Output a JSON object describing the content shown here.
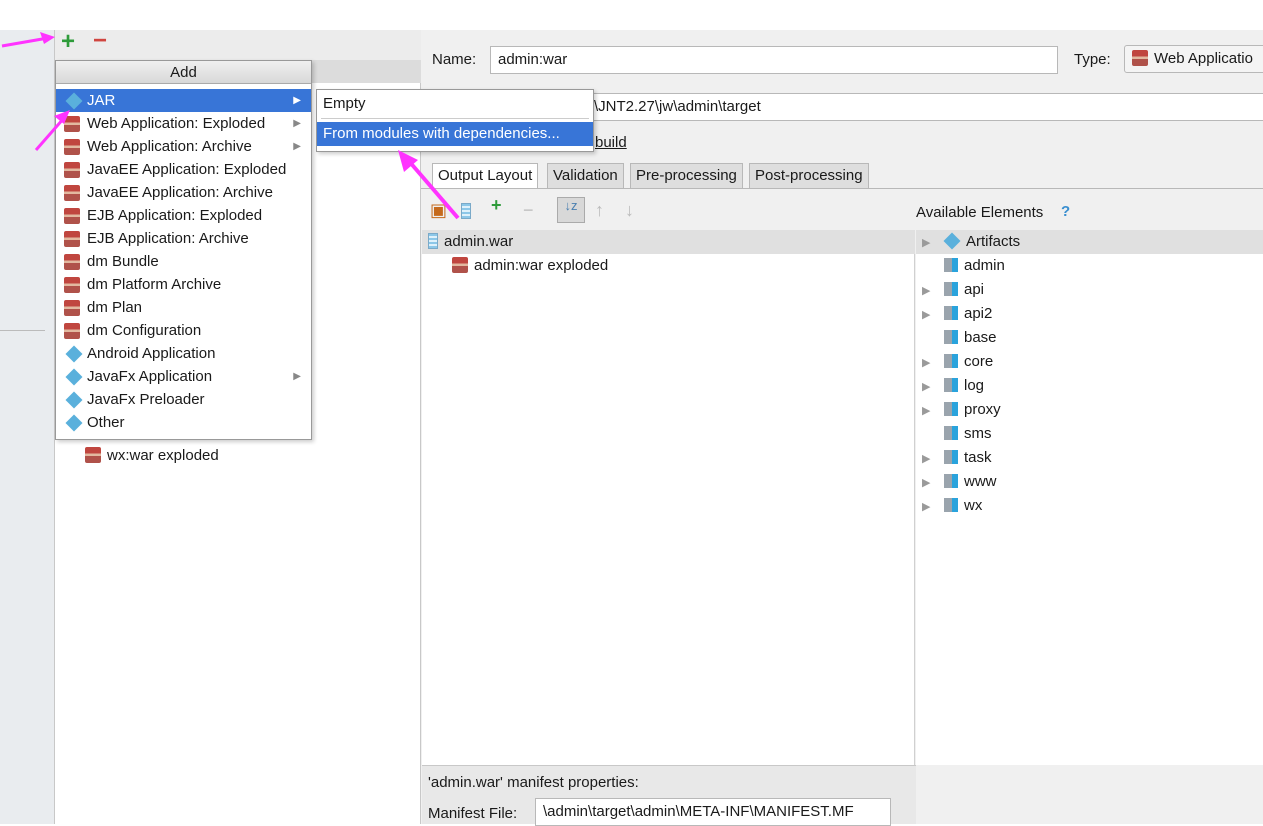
{
  "left_panel": {
    "toolbar": {
      "add_icon": "plus-icon",
      "remove_icon": "minus-icon"
    },
    "tree_items": [
      {
        "label": "wx:war exploded",
        "icon": "web-app-icon"
      }
    ]
  },
  "form": {
    "name_label": "Name:",
    "name_value": "admin:war",
    "type_label": "Type:",
    "type_value": "Web Applicatio",
    "output_dir_value": "\\JNT2.27\\jw\\admin\\target",
    "build_label": "build"
  },
  "tabs": [
    {
      "label": "Output Layout",
      "active": true
    },
    {
      "label": "Validation"
    },
    {
      "label": "Pre-processing"
    },
    {
      "label": "Post-processing"
    }
  ],
  "layout_tree": [
    {
      "label": "admin.war",
      "icon": "war-jar-icon",
      "selected": true
    },
    {
      "label": "admin:war exploded",
      "icon": "web-app-icon"
    }
  ],
  "available": {
    "title": "Available Elements",
    "help": "?",
    "items": [
      {
        "label": "Artifacts",
        "expandable": true,
        "icon": "artifacts-icon"
      },
      {
        "label": "admin",
        "expandable": false
      },
      {
        "label": "api",
        "expandable": true
      },
      {
        "label": "api2",
        "expandable": true
      },
      {
        "label": "base",
        "expandable": false
      },
      {
        "label": "core",
        "expandable": true
      },
      {
        "label": "log",
        "expandable": true
      },
      {
        "label": "proxy",
        "expandable": true
      },
      {
        "label": "sms",
        "expandable": false
      },
      {
        "label": "task",
        "expandable": true
      },
      {
        "label": "www",
        "expandable": true
      },
      {
        "label": "wx",
        "expandable": true
      }
    ]
  },
  "manifest": {
    "title": "'admin.war' manifest properties:",
    "file_label": "Manifest File:",
    "file_value": "\\admin\\target\\admin\\META-INF\\MANIFEST.MF"
  },
  "add_menu": {
    "title": "Add",
    "items": [
      {
        "label": "JAR",
        "icon": "jar-icon",
        "submenu": true,
        "highlighted": true
      },
      {
        "label": "Web Application: Exploded",
        "icon": "web-app-icon",
        "submenu": true
      },
      {
        "label": "Web Application: Archive",
        "icon": "web-app-icon",
        "submenu": true
      },
      {
        "label": "JavaEE Application: Exploded",
        "icon": "javaee-icon"
      },
      {
        "label": "JavaEE Application: Archive",
        "icon": "javaee-icon"
      },
      {
        "label": "EJB Application: Exploded",
        "icon": "ejb-icon"
      },
      {
        "label": "EJB Application: Archive",
        "icon": "ejb-icon"
      },
      {
        "label": "dm Bundle",
        "icon": "dm-bundle-icon"
      },
      {
        "label": "dm Platform Archive",
        "icon": "dm-platform-icon"
      },
      {
        "label": "dm Plan",
        "icon": "dm-plan-icon"
      },
      {
        "label": "dm Configuration",
        "icon": "dm-config-icon"
      },
      {
        "label": "Android Application",
        "icon": "android-icon"
      },
      {
        "label": "JavaFx Application",
        "icon": "javafx-icon",
        "submenu": true
      },
      {
        "label": "JavaFx Preloader",
        "icon": "javafx-icon"
      },
      {
        "label": "Other",
        "icon": "other-icon"
      }
    ],
    "submenu": [
      {
        "label": "Empty"
      },
      {
        "label": "From modules with dependencies...",
        "highlighted": true
      }
    ]
  },
  "colors": {
    "highlight": "#3875d7",
    "annotation_arrow": "#ff33ff"
  }
}
